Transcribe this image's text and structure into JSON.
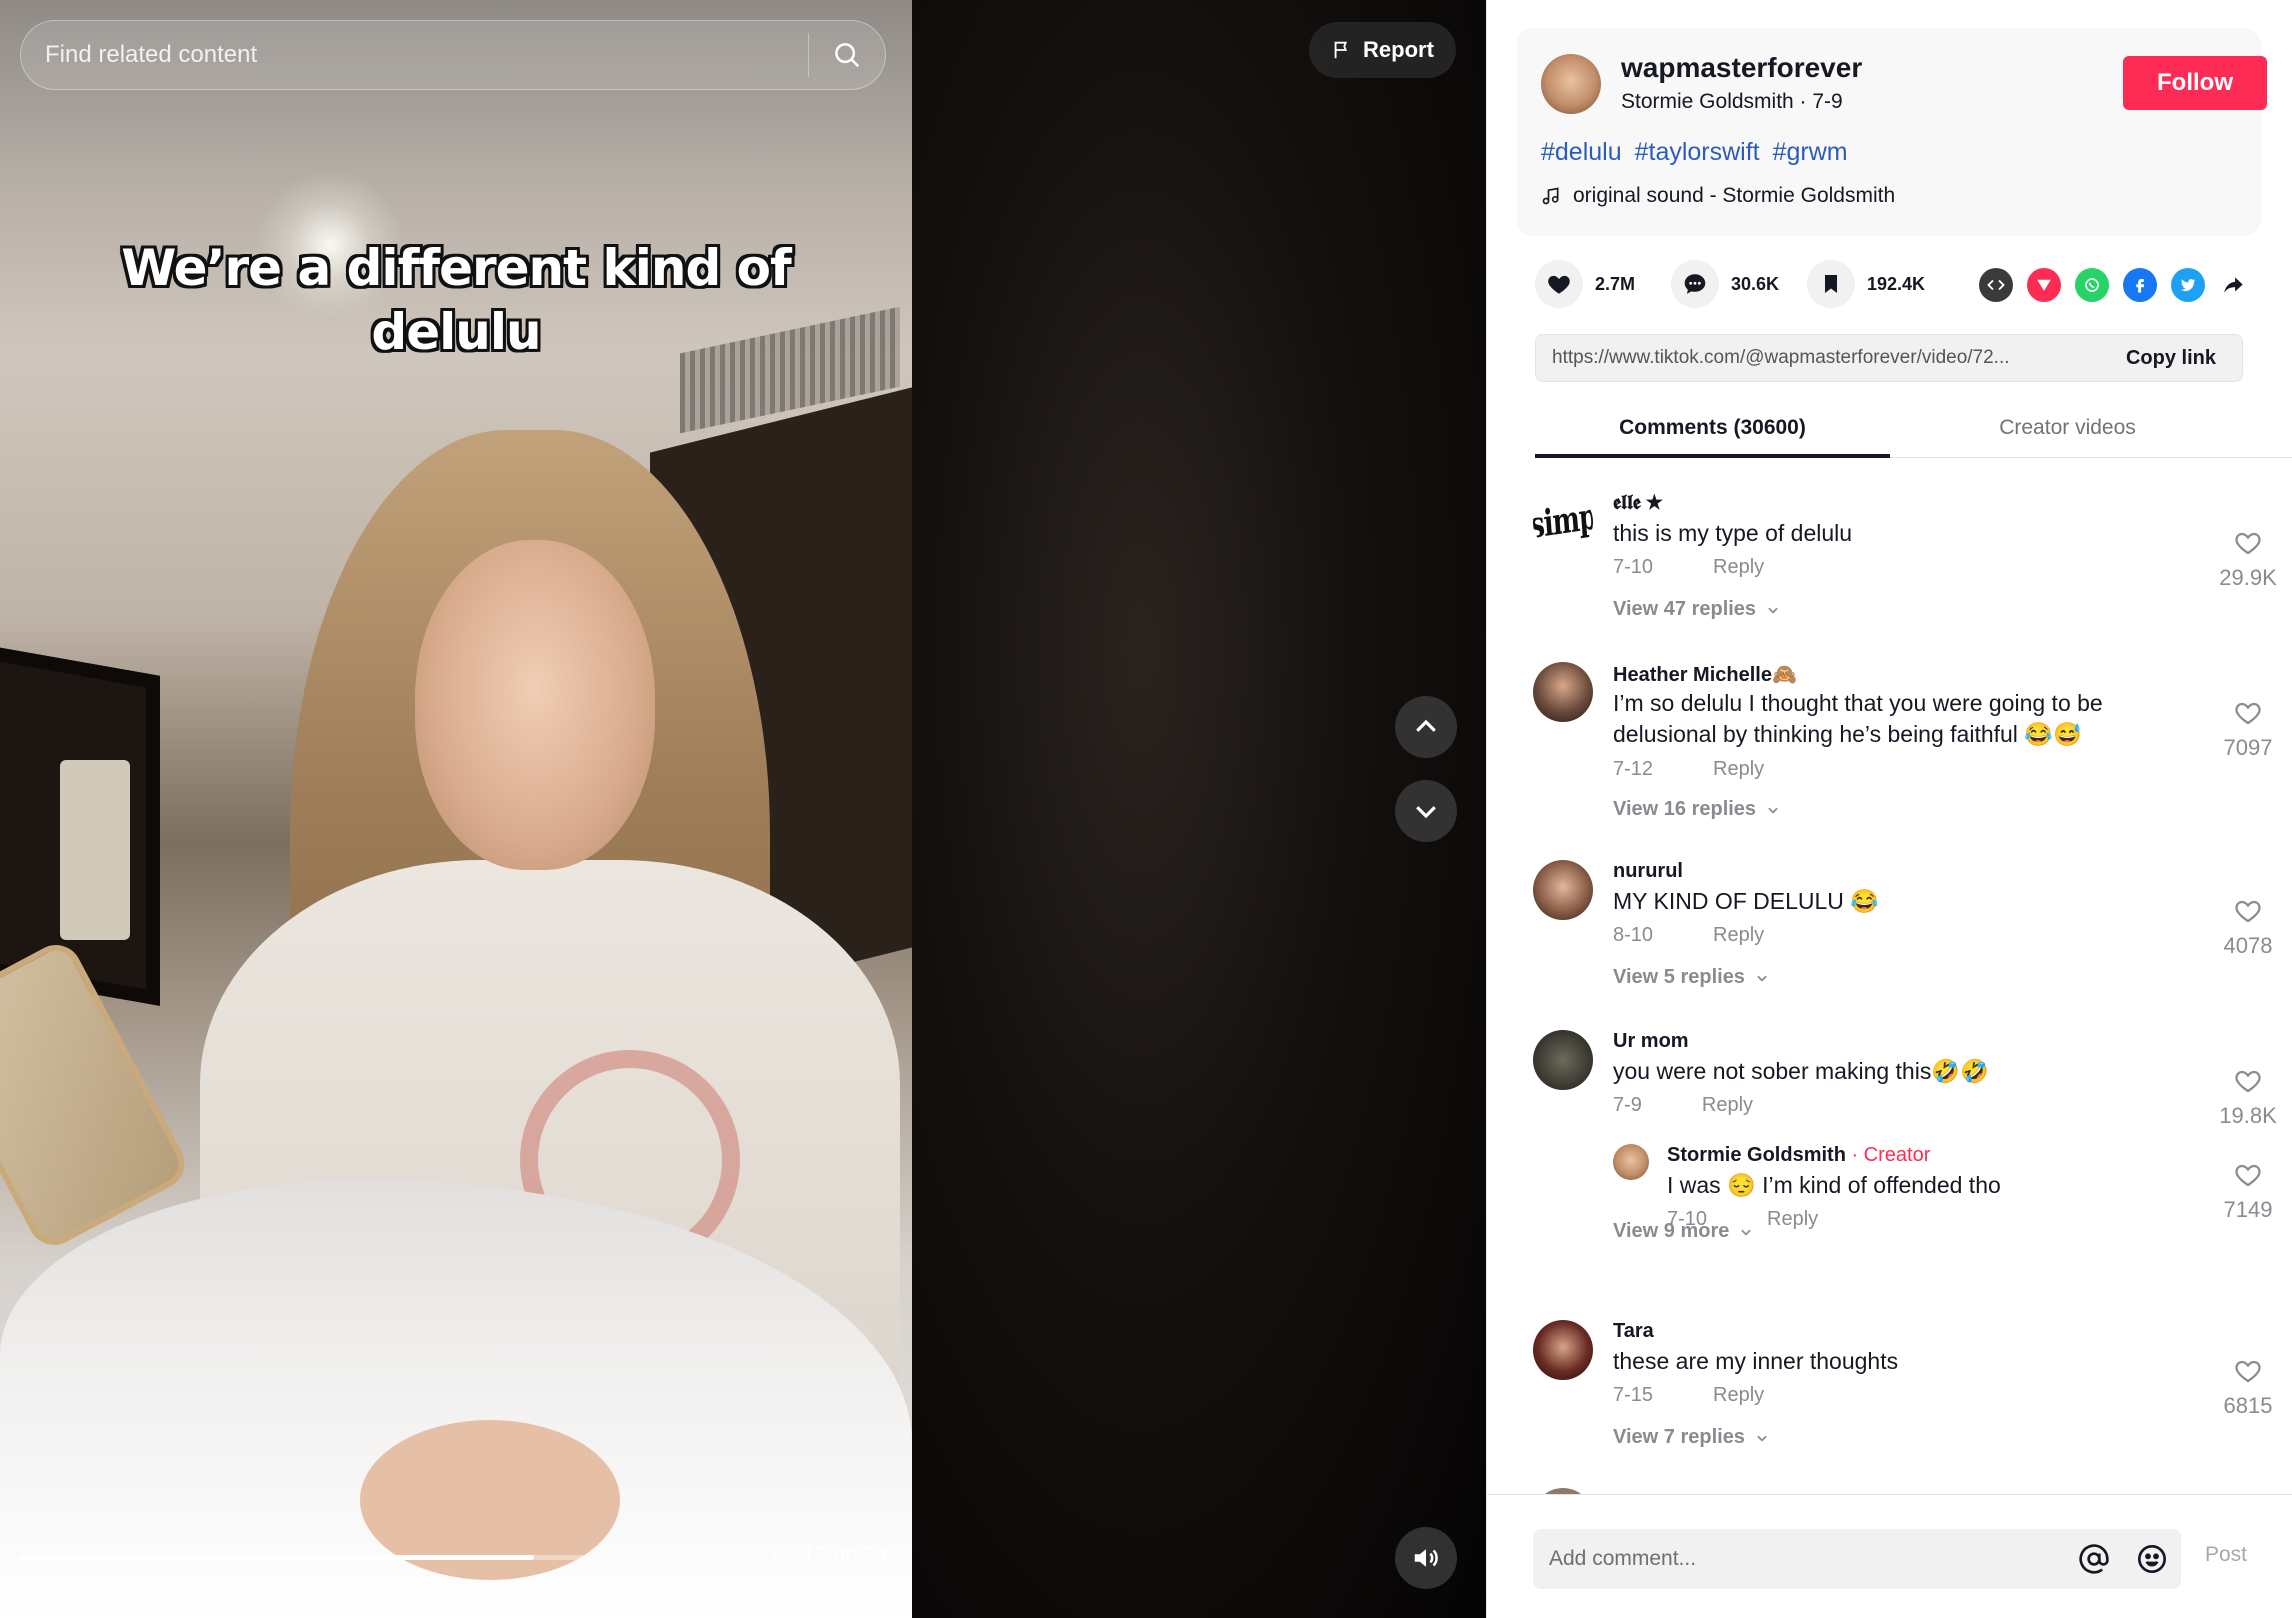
{
  "search": {
    "placeholder": "Find related content"
  },
  "video": {
    "caption_line1": "We’re a different kind of",
    "caption_line2": "delulu",
    "time": "00:17/00:24",
    "progress_fraction": 0.71
  },
  "report": {
    "label": "Report"
  },
  "author": {
    "username": "wapmasterforever",
    "subline": "Stormie Goldsmith · 7-9",
    "follow_label": "Follow",
    "hashtags": [
      "#delulu",
      "#taylorswift",
      "#grwm"
    ],
    "music": "original sound - Stormie Goldsmith"
  },
  "stats": {
    "likes": "2.7M",
    "comments": "30.6K",
    "saves": "192.4K"
  },
  "share": {
    "link": "https://www.tiktok.com/@wapmasterforever/video/72...",
    "copy_label": "Copy link",
    "colors": {
      "embed": "#3a3a3a",
      "send": "#fe2c55",
      "whatsapp": "#25d366",
      "facebook": "#1877f2",
      "twitter": "#1da1f2"
    }
  },
  "tabs": {
    "comments": "Comments (30600)",
    "creator": "Creator videos"
  },
  "comments": [
    {
      "name": "𝖊𝖑𝖑𝖊 ★",
      "avatar_text": "simp",
      "text": "this is my type of delulu",
      "date": "7-10",
      "reply": "Reply",
      "likes": "29.9K",
      "view": "View 47 replies"
    },
    {
      "name": "Heather Michelle🙈",
      "text": "I’m so delulu I thought that you were going to be delusional by thinking he’s being faithful 😂😅",
      "date": "7-12",
      "reply": "Reply",
      "likes": "7097",
      "view": "View 16 replies"
    },
    {
      "name": "nururul",
      "text": "MY KIND OF DELULU 😂",
      "date": "8-10",
      "reply": "Reply",
      "likes": "4078",
      "view": "View 5 replies"
    },
    {
      "name": "Ur mom",
      "text": "you were not sober making this🤣🤣",
      "date": "7-9",
      "reply": "Reply",
      "likes": "19.8K",
      "view": "View 9 more",
      "nested": {
        "name": "Stormie Goldsmith",
        "badge": " · Creator",
        "text": "I was 😔 I’m kind of offended tho",
        "date": "7-10",
        "reply": "Reply",
        "likes": "7149"
      }
    },
    {
      "name": "Tara",
      "text": "these are my inner thoughts",
      "date": "7-15",
      "reply": "Reply",
      "likes": "6815",
      "view": "View 7 replies"
    }
  ],
  "comment_bar": {
    "placeholder": "Add comment...",
    "post_label": "Post"
  }
}
